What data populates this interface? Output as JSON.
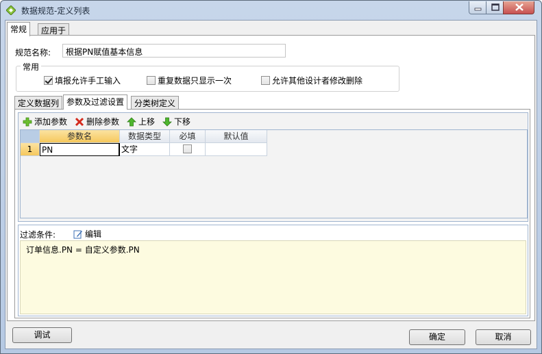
{
  "window": {
    "title": "数据规范-定义列表",
    "icon": "diamond-app-icon",
    "accent_color": "#b6c9e3"
  },
  "main_tabs": [
    {
      "label": "常规",
      "active": true
    },
    {
      "label": "应用于",
      "active": false
    }
  ],
  "general": {
    "spec_name_label": "规范名称:",
    "spec_name_value": "根据PN赋值基本信息",
    "group_title": "常用",
    "checkboxes": [
      {
        "label": "填报允许手工输入",
        "checked": true
      },
      {
        "label": "重复数据只显示一次",
        "checked": false
      },
      {
        "label": "允许其他设计者修改删除",
        "checked": false
      }
    ]
  },
  "sub_tabs": [
    {
      "label": "定义数据列",
      "active": false
    },
    {
      "label": "参数及过滤设置",
      "active": true
    },
    {
      "label": "分类树定义",
      "active": false
    }
  ],
  "toolbar": {
    "add_label": "添加参数",
    "delete_label": "删除参数",
    "up_label": "上移",
    "down_label": "下移"
  },
  "grid": {
    "columns": [
      "参数名",
      "数据类型",
      "必填",
      "默认值"
    ],
    "rows": [
      {
        "index": "1",
        "name": "PN",
        "type": "文字",
        "required": false,
        "default": ""
      }
    ]
  },
  "filter": {
    "label": "过滤条件:",
    "edit_label": "编辑",
    "expression": "订单信息.PN = 自定义参数.PN"
  },
  "footer": {
    "debug_label": "调试",
    "ok_label": "确定",
    "cancel_label": "取消"
  }
}
